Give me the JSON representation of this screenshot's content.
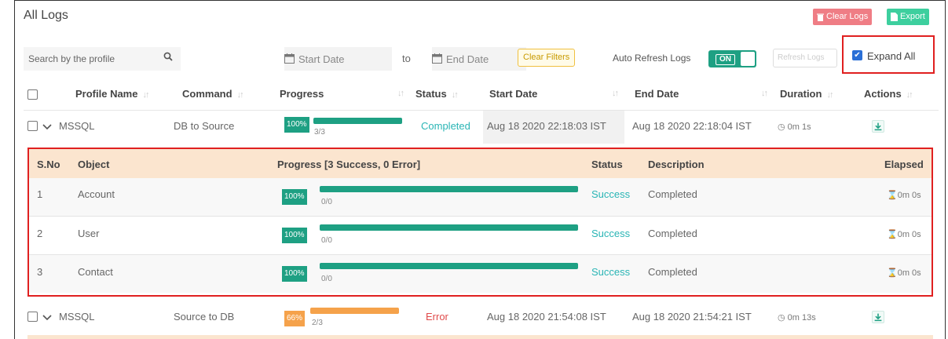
{
  "page": {
    "title": "All Logs",
    "clear_logs_label": "Clear Logs",
    "export_label": "Export"
  },
  "filters": {
    "search_placeholder": "Search by the profile",
    "start_date_placeholder": "Start Date",
    "to_label": "to",
    "end_date_placeholder": "End Date",
    "clear_filters_label": "Clear Filters",
    "auto_refresh_label": "Auto Refresh Logs",
    "auto_refresh_state": "ON",
    "refresh_logs_label": "Refresh Logs",
    "expand_all_label": "Expand All",
    "expand_all_checked": true
  },
  "table": {
    "columns": {
      "profile_name": "Profile Name",
      "command": "Command",
      "progress": "Progress",
      "status": "Status",
      "start_date": "Start Date",
      "end_date": "End Date",
      "duration": "Duration",
      "actions": "Actions"
    },
    "rows": [
      {
        "profile": "MSSQL",
        "command": "DB to Source",
        "progress_label": "100%",
        "progress_fraction": 1.0,
        "progress_count": "3/3",
        "progress_color": "#1ea083",
        "status": "Completed",
        "start_date": "Aug 18 2020 22:18:03 IST",
        "end_date": "Aug 18 2020 22:18:04 IST",
        "duration": "0m 1s"
      },
      {
        "profile": "MSSQL",
        "command": "Source to DB",
        "progress_label": "66%",
        "progress_fraction": 0.66,
        "progress_count": "2/3",
        "progress_color": "#f5a24b",
        "status": "Error",
        "start_date": "Aug 18 2020 21:54:08 IST",
        "end_date": "Aug 18 2020 21:54:21 IST",
        "duration": "0m 13s"
      }
    ]
  },
  "details": {
    "columns": {
      "sno": "S.No",
      "object": "Object",
      "progress": "Progress [3 Success, 0 Error]",
      "status": "Status",
      "description": "Description",
      "elapsed": "Elapsed"
    },
    "rows": [
      {
        "sno": "1",
        "object": "Account",
        "progress_label": "100%",
        "progress_count": "0/0",
        "status": "Success",
        "description": "Completed",
        "elapsed": "0m 0s"
      },
      {
        "sno": "2",
        "object": "User",
        "progress_label": "100%",
        "progress_count": "0/0",
        "status": "Success",
        "description": "Completed",
        "elapsed": "0m 0s"
      },
      {
        "sno": "3",
        "object": "Contact",
        "progress_label": "100%",
        "progress_count": "0/0",
        "status": "Success",
        "description": "Completed",
        "elapsed": "0m 0s"
      }
    ]
  },
  "colors": {
    "accent_green": "#1ea083",
    "status_success": "#2ab5b5",
    "status_error": "#e04a4a",
    "progress_warn": "#f5a24b",
    "highlight_red": "#e02020",
    "detail_header_bg": "#fbe5cf"
  },
  "icons": {
    "clear_logs": "trash-icon",
    "export": "file-icon",
    "search": "search-icon",
    "calendar": "calendar-icon",
    "row_select": "checkbox-icon",
    "row_expand": "chevron-down-icon",
    "duration": "clock-icon",
    "download": "download-icon",
    "elapsed": "hourglass-icon"
  }
}
